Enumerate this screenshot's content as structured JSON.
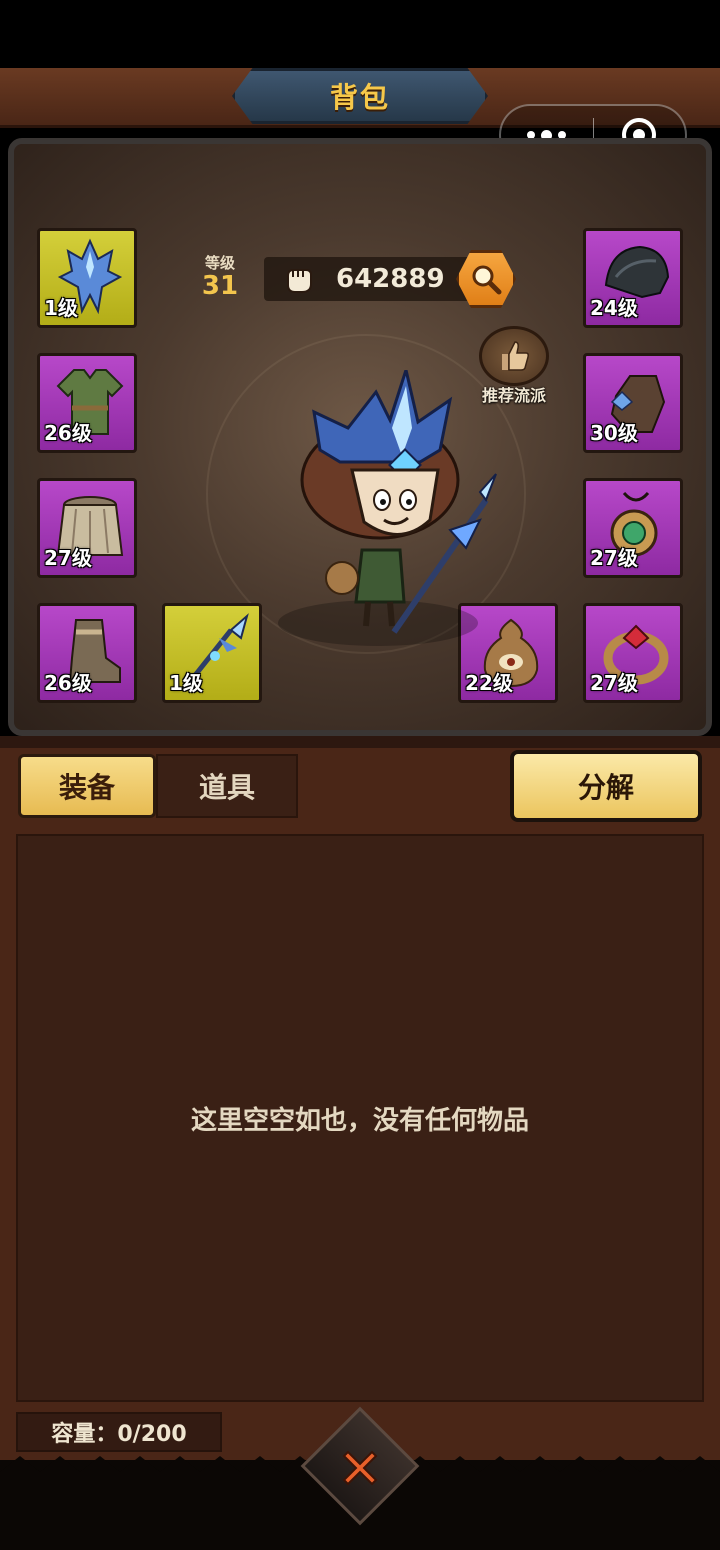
{
  "header": {
    "title": "背包"
  },
  "capsule": {
    "menu_icon": "more-dots-icon",
    "close_icon": "target-circle-icon"
  },
  "hero": {
    "level_label": "等级",
    "level_value": "31",
    "power_value": "642889",
    "recommend_label": "推荐流派"
  },
  "slots": {
    "helmet": {
      "level": "1级",
      "rarity": "gold"
    },
    "armor": {
      "level": "26级",
      "rarity": "purple"
    },
    "belt": {
      "level": "27级",
      "rarity": "purple"
    },
    "boots": {
      "level": "26级",
      "rarity": "purple"
    },
    "weapon": {
      "level": "1级",
      "rarity": "gold"
    },
    "shoulder": {
      "level": "24级",
      "rarity": "purple"
    },
    "gloves": {
      "level": "30级",
      "rarity": "purple"
    },
    "necklace": {
      "level": "27级",
      "rarity": "purple"
    },
    "pouch": {
      "level": "22级",
      "rarity": "purple"
    },
    "ring": {
      "level": "27级",
      "rarity": "purple"
    }
  },
  "tabs": [
    {
      "label": "装备",
      "active": true
    },
    {
      "label": "道具",
      "active": false
    }
  ],
  "decompose_label": "分解",
  "inventory": {
    "empty_text": "这里空空如也，没有任何物品"
  },
  "capacity": {
    "text": "容量：0/200"
  },
  "colors": {
    "gold_slot": "#c9c42a",
    "purple_slot": "#a53bb9",
    "accent_text": "#f3c54d",
    "panel_bg": "#3a2015"
  }
}
